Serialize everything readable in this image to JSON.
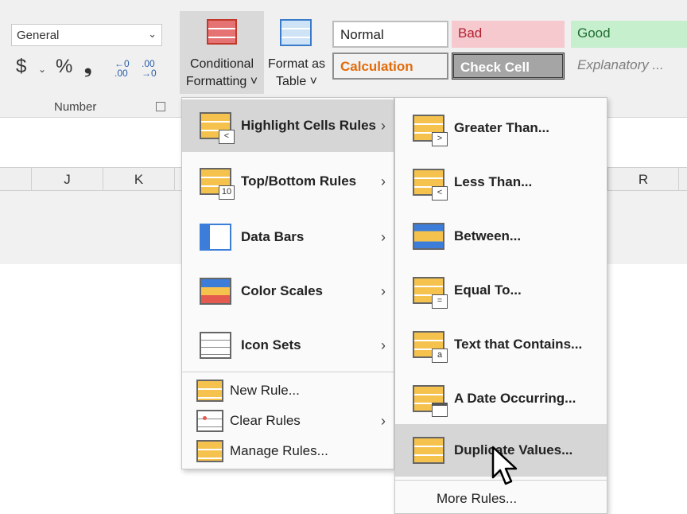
{
  "ribbon": {
    "number_format": "General",
    "currency": "$",
    "percent": "%",
    "comma": "❟",
    "dec_inc": "←0\n.00",
    "dec_dec": ".00\n→0",
    "number_group": "Number",
    "conditional_formatting": "Conditional Formatting ˅",
    "format_as_table": "Format as Table ˅",
    "styles": {
      "normal": "Normal",
      "bad": "Bad",
      "good": "Good",
      "calculation": "Calculation",
      "check_cell": "Check Cell",
      "explanatory": "Explanatory ..."
    }
  },
  "sheet": {
    "columns": [
      "J",
      "K",
      "R"
    ]
  },
  "cf_menu": {
    "items": [
      {
        "label": "Highlight Cells Rules"
      },
      {
        "label": "Top/Bottom Rules"
      },
      {
        "label": "Data Bars"
      },
      {
        "label": "Color Scales"
      },
      {
        "label": "Icon Sets"
      },
      {
        "label": "New Rule..."
      },
      {
        "label": "Clear Rules"
      },
      {
        "label": "Manage Rules..."
      }
    ]
  },
  "sub_menu": {
    "items": [
      {
        "label": "Greater Than..."
      },
      {
        "label": "Less Than..."
      },
      {
        "label": "Between..."
      },
      {
        "label": "Equal To..."
      },
      {
        "label": "Text that Contains..."
      },
      {
        "label": "A Date Occurring..."
      },
      {
        "label": "Duplicate Values..."
      },
      {
        "label": "More Rules..."
      }
    ]
  },
  "icons": {
    "dropdown": "chevron-down-icon",
    "submenu": "chevron-right-icon",
    "cursor": "mouse-pointer-icon"
  },
  "colors": {
    "highlight": "#d6d6d6",
    "bad_fill": "#f6c9ce",
    "good_fill": "#c6efce",
    "calc_text": "#e26b0a"
  }
}
